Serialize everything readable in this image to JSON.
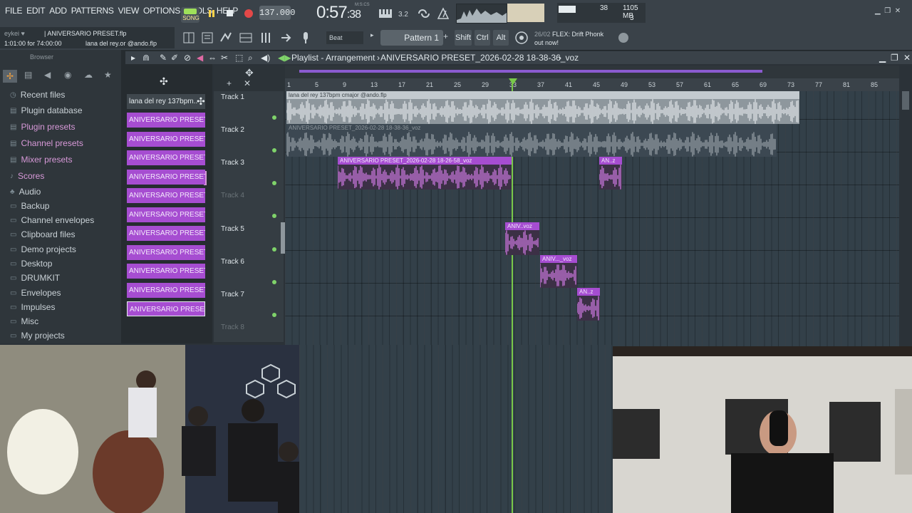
{
  "menu": [
    "FILE",
    "EDIT",
    "ADD",
    "PATTERNS",
    "VIEW",
    "OPTIONS",
    "TOOLS",
    "HELP"
  ],
  "transport": {
    "song_label": "SONG",
    "tempo": "137.000",
    "time_main": "0:57",
    "time_sec": ":38",
    "time_sub": "M:S:CS"
  },
  "resources": {
    "cpu_val": "38",
    "ram": "1105 MB",
    "poly": "3"
  },
  "hint": {
    "user": "eykei ♥",
    "title": "| ANIVERSARIO PRESET.flp",
    "position": "1:01:00 for 74:00:00",
    "file": "lana del rey.or @ando.flp"
  },
  "toolbar": {
    "snap": "Beat",
    "pattern": "Pattern 1",
    "shift": "Shift",
    "ctrl": "Ctrl",
    "alt": "Alt"
  },
  "news": {
    "date": "26/02",
    "text": "FLEX: Drift Phonk",
    "text2": "out now!"
  },
  "browser": {
    "title": "Browser",
    "items": [
      {
        "label": "Recent files",
        "color": "normal"
      },
      {
        "label": "Plugin database",
        "color": "normal"
      },
      {
        "label": "Plugin presets",
        "color": "pink"
      },
      {
        "label": "Channel presets",
        "color": "pink"
      },
      {
        "label": "Mixer presets",
        "color": "pink"
      },
      {
        "label": "Scores",
        "color": "pink"
      },
      {
        "label": "Audio",
        "color": "normal"
      },
      {
        "label": "Backup",
        "color": "normal"
      },
      {
        "label": "Channel envelopes",
        "color": "normal"
      },
      {
        "label": "Clipboard files",
        "color": "normal"
      },
      {
        "label": "Demo projects",
        "color": "normal"
      },
      {
        "label": "Desktop",
        "color": "normal"
      },
      {
        "label": "DRUMKIT",
        "color": "normal"
      },
      {
        "label": "Envelopes",
        "color": "normal"
      },
      {
        "label": "Impulses",
        "color": "normal"
      },
      {
        "label": "Misc",
        "color": "normal"
      },
      {
        "label": "My projects",
        "color": "normal"
      }
    ]
  },
  "channels": [
    "lana del rey 137bpm..",
    "ANIVERSARIO PRESET_202...",
    "ANIVERSARIO PRESET_202...",
    "ANIVERSARIO PRESET_202...",
    "ANIVERSARIO PRESET_202...",
    "ANIVERSARIO PRESET_202...",
    "ANIVERSARIO PRESET_202...",
    "ANIVERSARIO PRESET_202...",
    "ANIVERSARIO PRESET_202...",
    "ANIVERSARIO PRESET_202...",
    "ANIVERSARIO PRESET_202...",
    "ANIVERSARIO PRESET_202..."
  ],
  "playlist": {
    "title": "Playlist - Arrangement",
    "arrangement": "ANIVERSARIO PRESET_2026-02-28 18-38-36_voz",
    "ruler": [
      "1",
      "5",
      "9",
      "13",
      "17",
      "21",
      "25",
      "29",
      "33",
      "37",
      "41",
      "45",
      "49",
      "53",
      "57",
      "61",
      "65",
      "69",
      "73",
      "77",
      "81",
      "85"
    ],
    "tracks": [
      "Track 1",
      "Track 2",
      "Track 3",
      "Track 4",
      "Track 5",
      "Track 6",
      "Track 7",
      "Track 8"
    ],
    "clips": [
      {
        "label": "lana del rey 137bpm cmajor @ando.flp",
        "style": "gray"
      },
      {
        "label": "ANIVERSARIO PRESET_2026-02-28 18-38-36_voz",
        "style": "gray2"
      },
      {
        "label": "ANIVERSARIO PRESET_2026-02-28 18-26-58_voz",
        "style": "purple"
      },
      {
        "label": "AN..z",
        "style": "purple"
      },
      {
        "label": "ANIV..voz",
        "style": "purple"
      },
      {
        "label": "ANIV..._voz",
        "style": "purple"
      },
      {
        "label": "AN..z",
        "style": "purple"
      }
    ]
  },
  "colors": {
    "accent": "#a64dd1",
    "playhead": "#79c84a",
    "grid": "#334049"
  }
}
